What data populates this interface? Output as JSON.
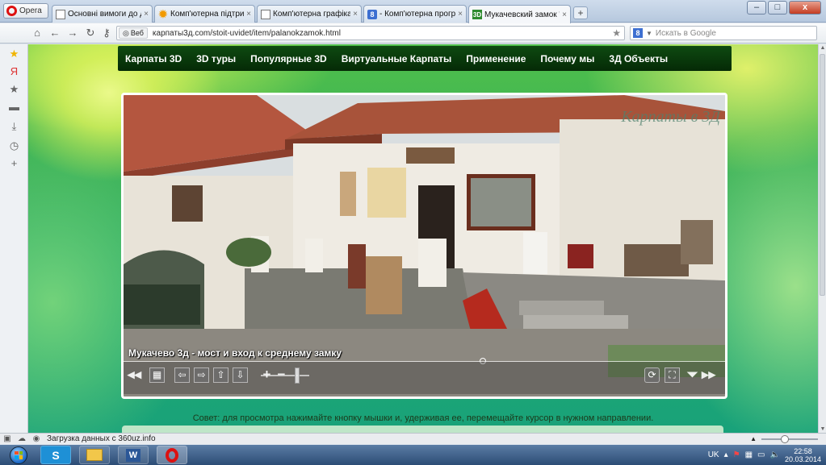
{
  "browser": {
    "opera_label": "Opera",
    "tabs": [
      {
        "title": "Основні вимоги до ди...",
        "icon": "document-icon"
      },
      {
        "title": "Комп'ютерна підтрим...",
        "icon": "sun-icon"
      },
      {
        "title": "Комп'ютерна графіка...",
        "icon": "document-icon"
      },
      {
        "title": "- Комп'ютерна прогр...",
        "icon": "yandex-8-icon"
      },
      {
        "title": "Мукачевский замок \"...",
        "icon": "3d-site-icon"
      }
    ],
    "tab_close": "×",
    "new_tab": "+",
    "window_buttons": {
      "minimize": "–",
      "maximize": "□",
      "close": "x"
    }
  },
  "address": {
    "badge": "Веб",
    "url": "карпаты3д.com/stoit-uvidet/item/palanokzamok.html",
    "search_placeholder": "Искать в Google",
    "search_engine_glyph": "8"
  },
  "site": {
    "menu": [
      "Карпаты 3D",
      "3D туры",
      "Популярные 3D",
      "Виртуальные Карпаты",
      "Применение",
      "Почему мы",
      "3Д Объекты"
    ],
    "watermark": "Карпаты в 3Д",
    "caption": "Мукачево 3д - мост и вход к среднему замку",
    "tip": "Совет:  для просмотра нажимайте кнопку мышки и, удерживая ее, перемещайте курсор в нужном направлении."
  },
  "statusbar": {
    "text": "Загрузка данных с 360uz.info"
  },
  "taskbar": {
    "lang": "UK",
    "time": "22:58",
    "date": "20.03.2014"
  },
  "colors": {
    "menu_bg": "#0a3d0c",
    "page_green": "#2fae5f",
    "accent_yellow": "#e2f37a"
  }
}
